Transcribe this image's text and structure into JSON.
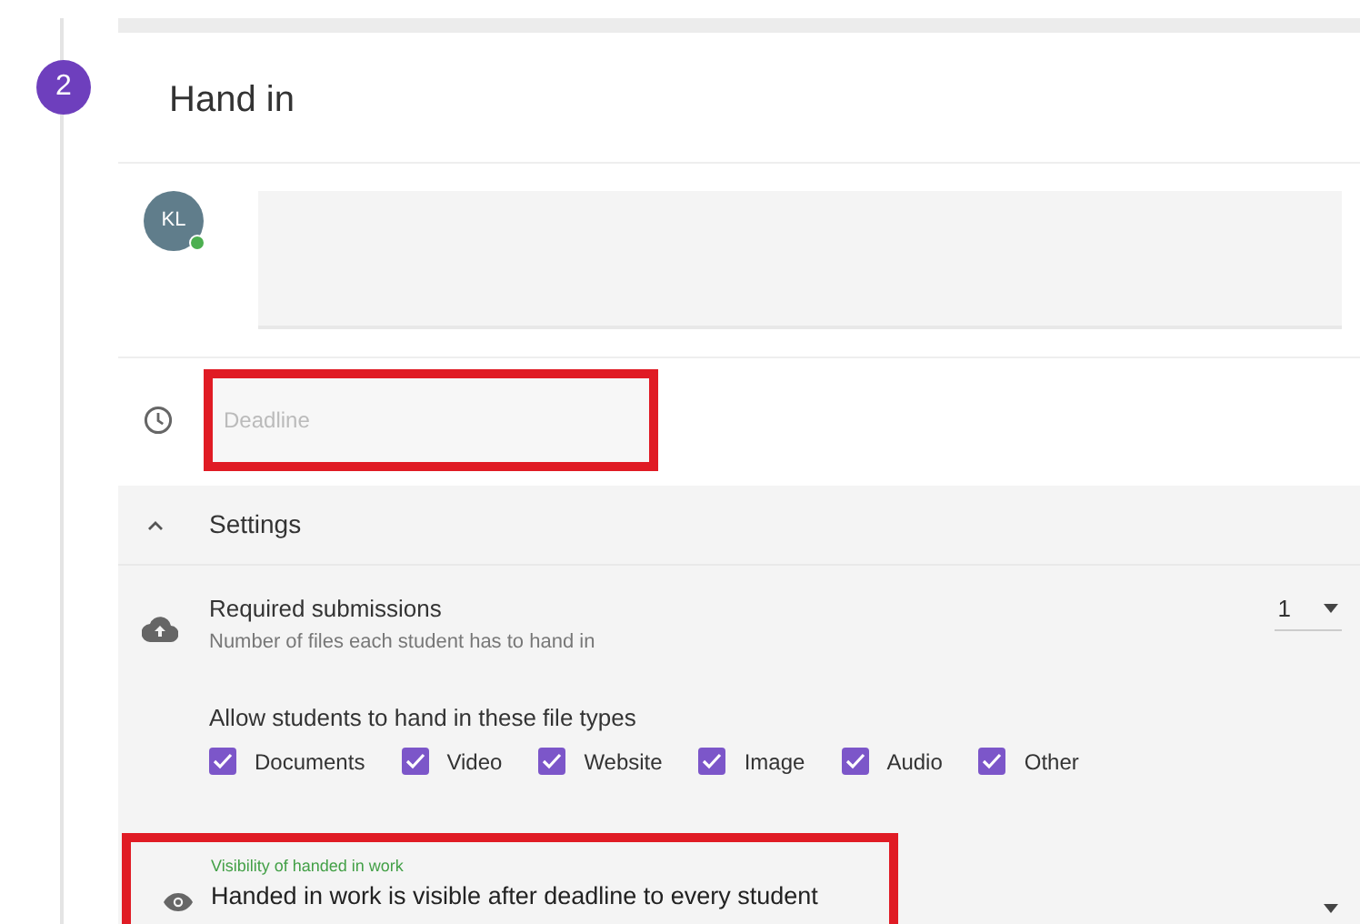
{
  "step": {
    "number": "2"
  },
  "card": {
    "title": "Hand in"
  },
  "comment": {
    "avatar_initials": "KL",
    "online": true
  },
  "deadline": {
    "placeholder": "Deadline",
    "highlighted": true
  },
  "settings": {
    "title": "Settings",
    "expanded": true,
    "required_submissions": {
      "label": "Required submissions",
      "hint": "Number of files each student has to hand in",
      "value": "1"
    },
    "file_types": {
      "label": "Allow students to hand in these file types",
      "options": [
        {
          "label": "Documents",
          "checked": true
        },
        {
          "label": "Video",
          "checked": true
        },
        {
          "label": "Website",
          "checked": true
        },
        {
          "label": "Image",
          "checked": true
        },
        {
          "label": "Audio",
          "checked": true
        },
        {
          "label": "Other",
          "checked": true
        }
      ]
    },
    "visibility": {
      "label": "Visibility of handed in work",
      "value": "Handed in work is visible after deadline to every student",
      "highlighted": true
    }
  }
}
